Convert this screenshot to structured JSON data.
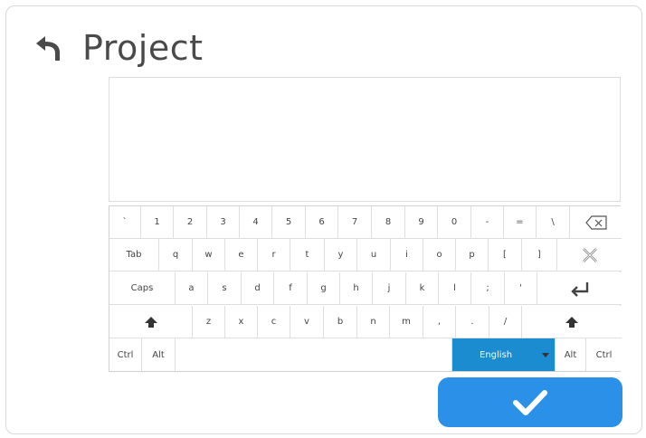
{
  "header": {
    "title": "Project",
    "back_icon": "back-arrow-icon"
  },
  "text_input": {
    "value": ""
  },
  "keyboard": {
    "rows": [
      [
        "`",
        "1",
        "2",
        "3",
        "4",
        "5",
        "6",
        "7",
        "8",
        "9",
        "0",
        "-",
        "=",
        "\\",
        "backspace"
      ],
      [
        "Tab",
        "q",
        "w",
        "e",
        "r",
        "t",
        "y",
        "u",
        "i",
        "o",
        "p",
        "[",
        "]",
        "clear"
      ],
      [
        "Caps",
        "a",
        "s",
        "d",
        "f",
        "g",
        "h",
        "j",
        "k",
        "l",
        ";",
        "'",
        "enter"
      ],
      [
        "shift",
        "z",
        "x",
        "c",
        "v",
        "b",
        "n",
        "m",
        ",",
        ".",
        "/",
        "shift"
      ],
      [
        "Ctrl",
        "Alt",
        "space",
        "English",
        "Alt",
        "Ctrl"
      ]
    ],
    "language": "English"
  },
  "confirm_icon": "checkmark-icon",
  "colors": {
    "accent": "#2a90e8",
    "language_key": "#1a8ccf",
    "text": "#444444"
  }
}
